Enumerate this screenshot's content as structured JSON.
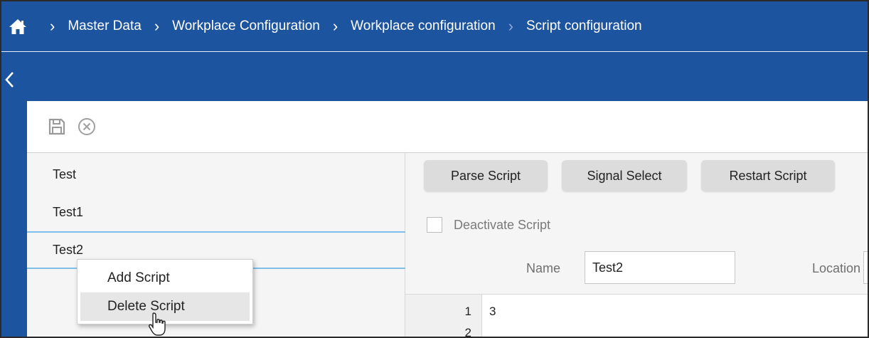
{
  "breadcrumb": {
    "items": [
      "Master Data",
      "Workplace Configuration",
      "Workplace configuration",
      "Script configuration"
    ]
  },
  "icons": {
    "home": "home-icon",
    "back": "chevron-left-icon",
    "save": "save-icon",
    "cancel": "cancel-circle-icon",
    "cursor": "mouse-pointer-icon"
  },
  "colors": {
    "brand_blue": "#1c54a0",
    "selection_line": "#7fc0ea",
    "button_bg": "#dcdcdc",
    "pane_bg": "#f5f5f5"
  },
  "scripts": {
    "items": [
      {
        "label": "Test"
      },
      {
        "label": "Test1"
      },
      {
        "label": "Test2"
      }
    ],
    "selected": "Test2"
  },
  "toolbar": {
    "parse_label": "Parse Script",
    "signal_label": "Signal Select",
    "restart_label": "Restart Script"
  },
  "form": {
    "deactivate_label": "Deactivate Script",
    "name_label": "Name",
    "name_value": "Test2",
    "location_label": "Location"
  },
  "editor": {
    "lines": [
      {
        "number": "1",
        "text": "3"
      },
      {
        "number": "2",
        "text": ""
      }
    ]
  },
  "context_menu": {
    "add_label": "Add Script",
    "delete_label": "Delete Script"
  }
}
